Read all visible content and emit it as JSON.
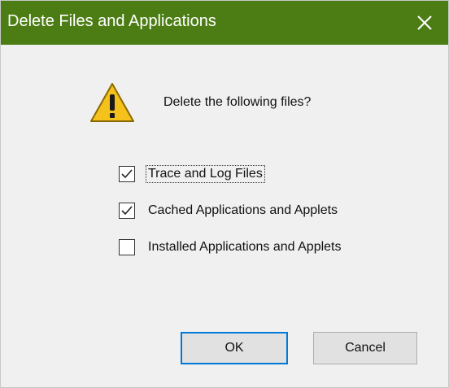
{
  "window": {
    "title": "Delete Files and Applications",
    "titlebar_color": "#4c7d14",
    "close_icon": "close-icon"
  },
  "dialog": {
    "icon": "warning-icon",
    "message": "Delete the following files?"
  },
  "options": [
    {
      "label": "Trace and Log Files",
      "checked": true
    },
    {
      "label": "Cached Applications and Applets",
      "checked": true
    },
    {
      "label": "Installed Applications and Applets",
      "checked": false
    }
  ],
  "buttons": {
    "ok_label": "OK",
    "cancel_label": "Cancel"
  }
}
